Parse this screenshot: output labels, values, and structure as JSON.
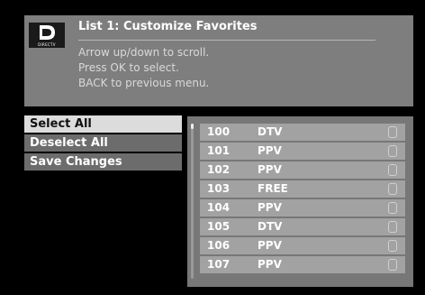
{
  "header": {
    "logo_text": "DIRECTV",
    "title": "List 1: Customize Favorites",
    "instructions": [
      "Arrow up/down to scroll.",
      "Press OK to select.",
      "BACK to previous menu."
    ]
  },
  "menu": {
    "items": [
      {
        "label": "Select All",
        "selected": true
      },
      {
        "label": "Deselect All",
        "selected": false
      },
      {
        "label": "Save Changes",
        "selected": false
      }
    ]
  },
  "channels": [
    {
      "number": "100",
      "type": "DTV",
      "checked": false
    },
    {
      "number": "101",
      "type": "PPV",
      "checked": false
    },
    {
      "number": "102",
      "type": "PPV",
      "checked": false
    },
    {
      "number": "103",
      "type": "FREE",
      "checked": false
    },
    {
      "number": "104",
      "type": "PPV",
      "checked": false
    },
    {
      "number": "105",
      "type": "DTV",
      "checked": false
    },
    {
      "number": "106",
      "type": "PPV",
      "checked": false
    },
    {
      "number": "107",
      "type": "PPV",
      "checked": false
    }
  ],
  "colors": {
    "header_bg": "#7e7e7e",
    "menu_item_bg": "#6c6c6c",
    "menu_selected_bg": "#dcdcdc",
    "list_bg": "#777777",
    "row_bg": "#a2a2a2"
  }
}
